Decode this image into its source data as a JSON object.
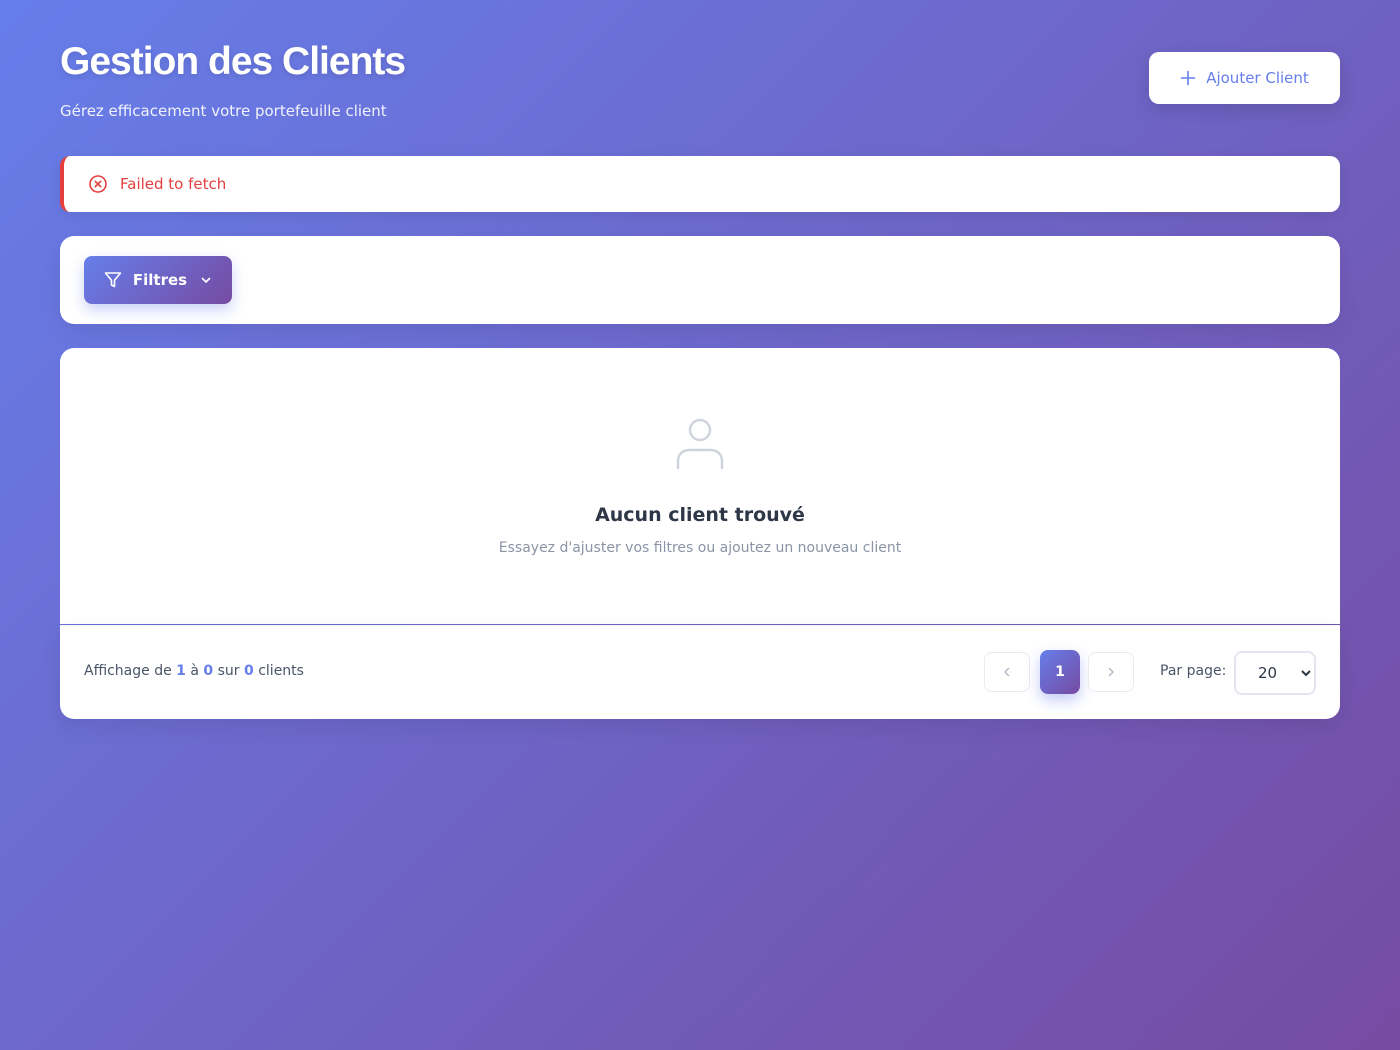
{
  "header": {
    "title": "Gestion des Clients",
    "subtitle": "Gérez efficacement votre portefeuille client",
    "add_button_label": "Ajouter Client",
    "add_icon": "plus-icon"
  },
  "error": {
    "message": "Failed to fetch",
    "icon": "x-circle-icon",
    "color": "#e53e3e"
  },
  "filters": {
    "button_label": "Filtres",
    "icon": "filter-icon",
    "chevron_icon": "chevron-down-icon"
  },
  "empty_state": {
    "icon": "user-icon",
    "title": "Aucun client trouvé",
    "subtitle": "Essayez d'ajuster vos filtres ou ajoutez un nouveau client"
  },
  "pagination": {
    "summary_prefix": "Affichage de",
    "from": "1",
    "to_word": "à",
    "to": "0",
    "of_word": "sur",
    "total": "0",
    "suffix": "clients",
    "current_page": "1",
    "per_page_label": "Par page:",
    "per_page_value": "20",
    "per_page_options": [
      "20"
    ]
  },
  "colors": {
    "accent": "#667eea",
    "gradient_end": "#764ba2",
    "error": "#e53e3e"
  }
}
